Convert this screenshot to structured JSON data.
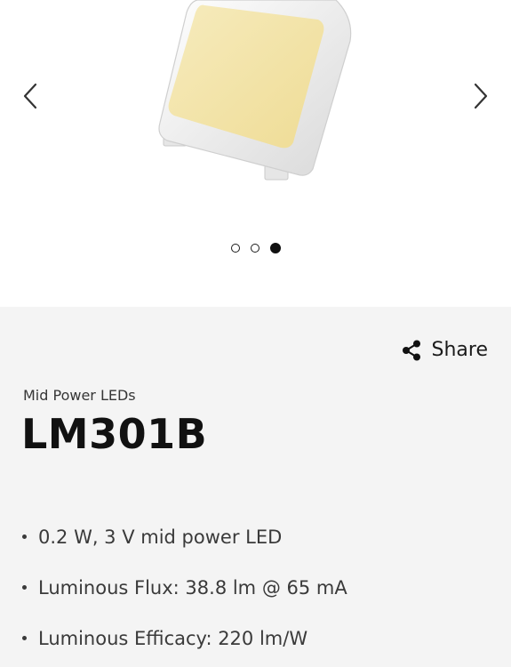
{
  "carousel": {
    "image_alt": "LM301B LED package",
    "prev_icon": "chevron-left-icon",
    "next_icon": "chevron-right-icon",
    "slides_total": 3,
    "active_slide": 3
  },
  "product": {
    "share_label": "Share",
    "share_icon": "share-icon",
    "category": "Mid Power LEDs",
    "title": "LM301B",
    "features": [
      "0.2 W, 3 V mid power LED",
      "Luminous Flux: 38.8 lm @ 65 mA",
      "Luminous Efficacy: 220 lm/W"
    ]
  },
  "colors": {
    "panel_background": "#f4f4f4",
    "led_emitter": "#f3e3a6",
    "text_primary": "#111111"
  }
}
